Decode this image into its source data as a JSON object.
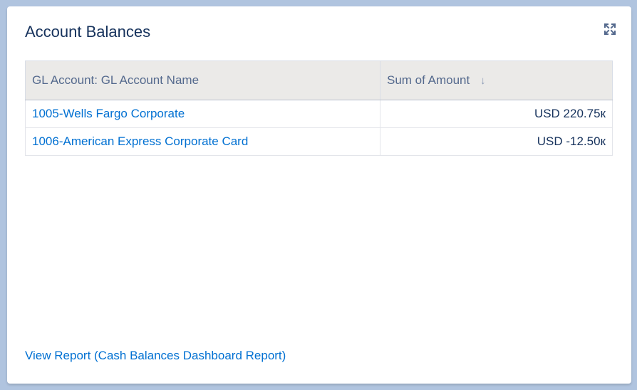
{
  "card": {
    "title": "Account Balances",
    "expand_icon": "expand-icon"
  },
  "table": {
    "columns": [
      {
        "label": "GL Account: GL Account Name"
      },
      {
        "label": "Sum of Amount",
        "sort_icon": "arrow-down-icon",
        "sort_glyph": "↓"
      }
    ],
    "rows": [
      {
        "name": "1005-Wells Fargo Corporate",
        "amount": "USD 220.75к"
      },
      {
        "name": "1006-American Express Corporate Card",
        "amount": "USD -12.50к"
      }
    ]
  },
  "footer": {
    "link_label": "View Report (Cash Balances Dashboard Report)"
  },
  "colors": {
    "link": "#0070d2",
    "title": "#16325c",
    "header_bg": "#ebeae8",
    "page_bg": "#b0c4df"
  }
}
